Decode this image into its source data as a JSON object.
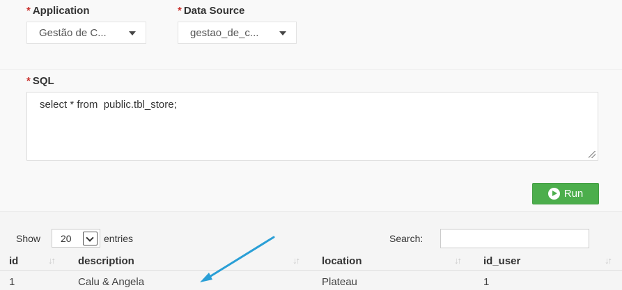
{
  "form": {
    "application": {
      "label": "Application",
      "required_mark": "*",
      "value": "Gestão de C..."
    },
    "data_source": {
      "label": "Data Source",
      "required_mark": "*",
      "value": "gestao_de_c..."
    },
    "sql": {
      "label": "SQL",
      "required_mark": "*",
      "value": "select * from  public.tbl_store;"
    },
    "run_label": "Run"
  },
  "table_controls": {
    "show_label": "Show",
    "page_size": "20",
    "entries_label": "entries",
    "search_label": "Search:",
    "search_value": ""
  },
  "table": {
    "columns": [
      "id",
      "description",
      "location",
      "id_user"
    ],
    "rows": [
      [
        "1",
        "Calu & Angela",
        "Plateau",
        "1"
      ]
    ]
  },
  "colors": {
    "required": "#c9302c",
    "run_button": "#4cae4c",
    "annotation_arrow": "#2a9fd6"
  },
  "icons": [
    "chevron-down-icon",
    "play-circle-icon",
    "sort-icon",
    "resize-handle-icon",
    "annotation-arrow"
  ]
}
